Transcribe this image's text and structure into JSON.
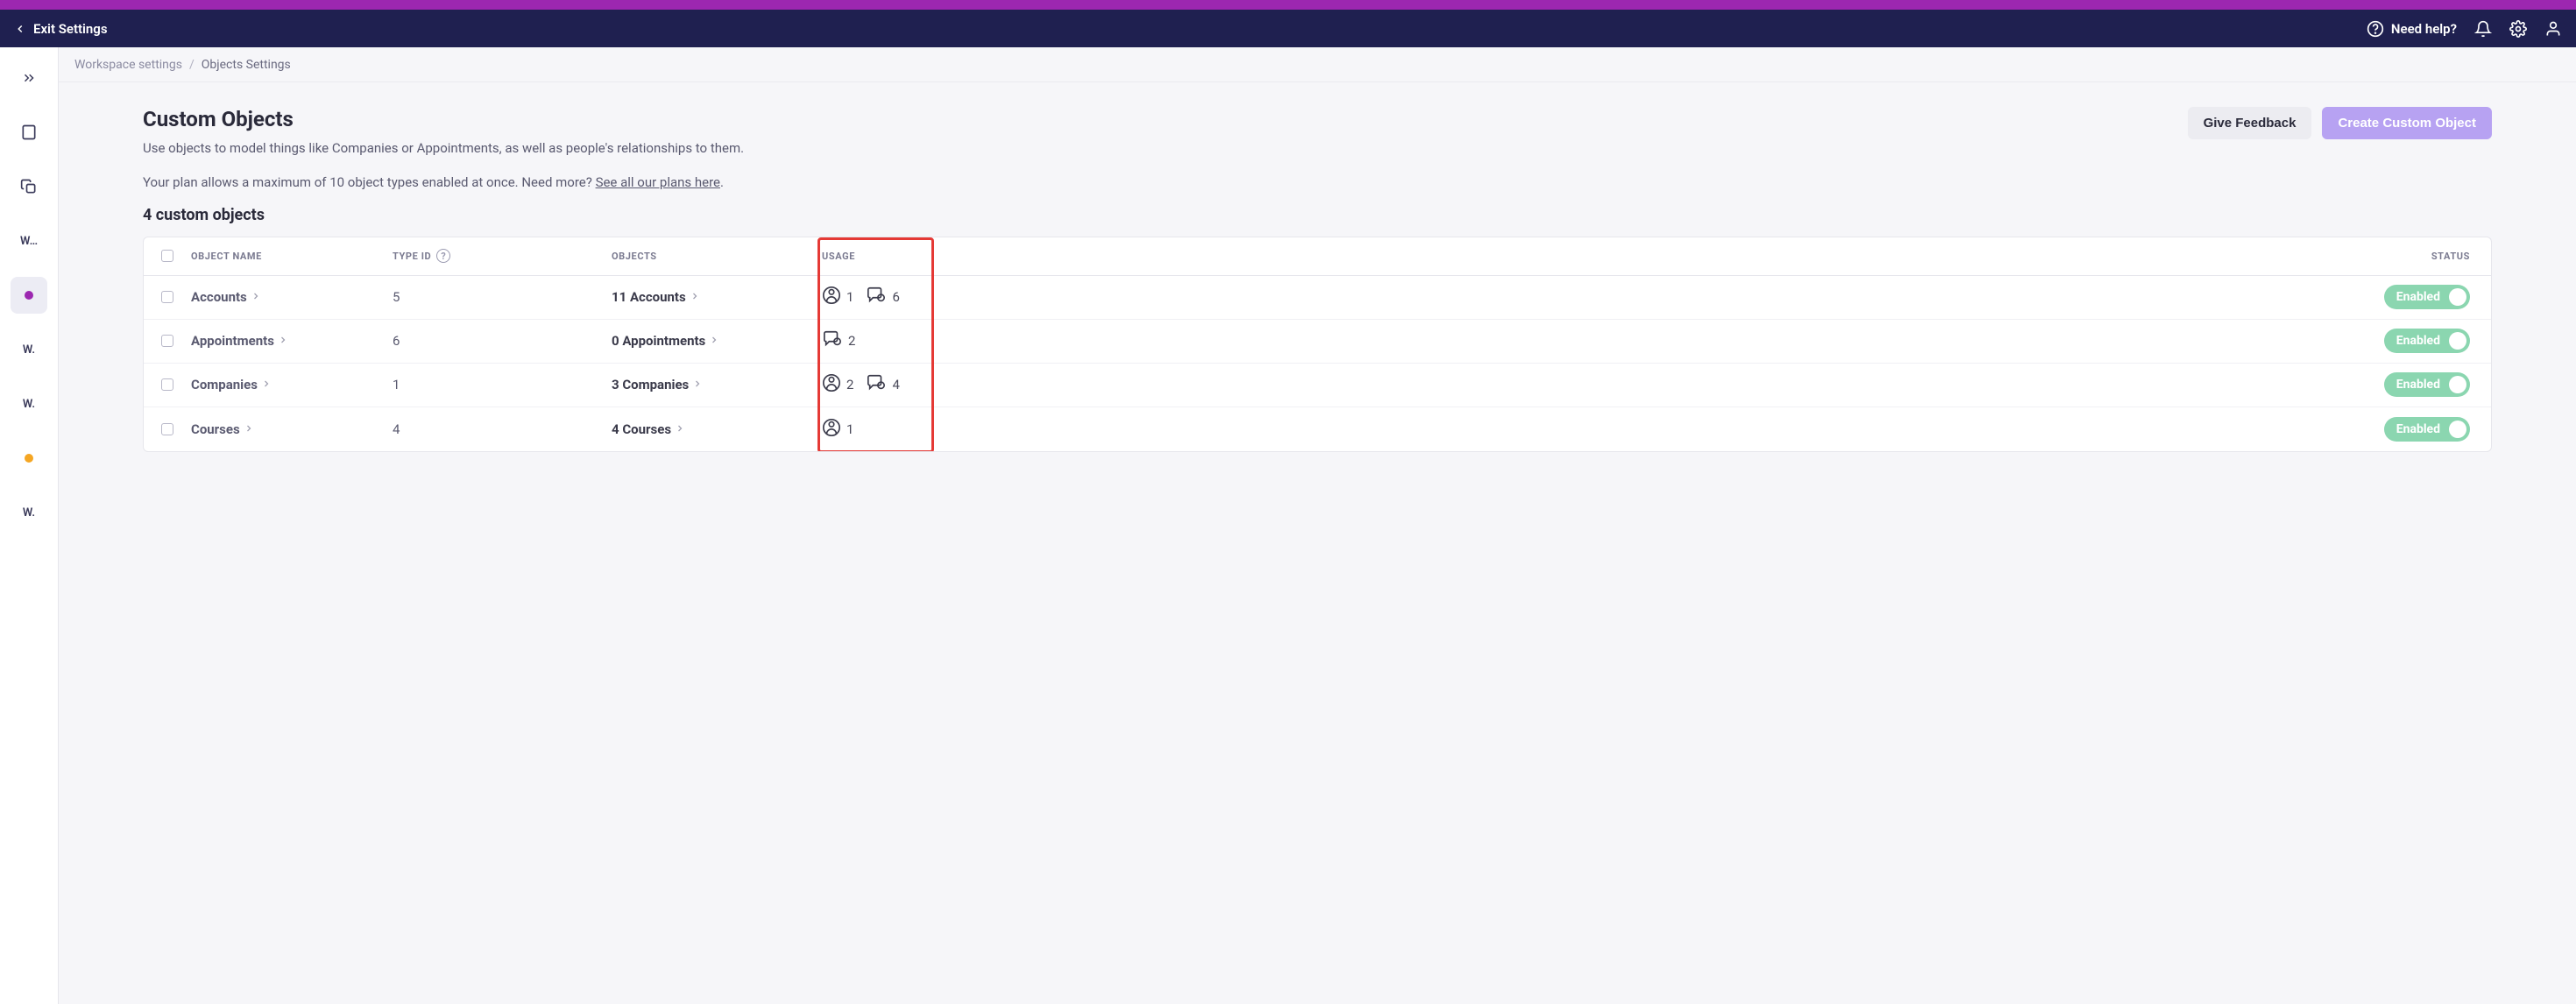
{
  "topbar": {
    "exit_label": "Exit Settings",
    "need_help": "Need help?"
  },
  "rail": {
    "items": [
      {
        "type": "expand"
      },
      {
        "type": "building"
      },
      {
        "type": "copy"
      },
      {
        "type": "text",
        "label": "W…"
      },
      {
        "type": "dot",
        "color": "#9c27b0",
        "active": true
      },
      {
        "type": "text",
        "label": "W."
      },
      {
        "type": "text",
        "label": "W."
      },
      {
        "type": "dot",
        "color": "#f5a623"
      },
      {
        "type": "text",
        "label": "W."
      }
    ]
  },
  "breadcrumb": {
    "root": "Workspace settings",
    "current": "Objects Settings"
  },
  "header": {
    "title": "Custom Objects",
    "description": "Use objects to model things like Companies or Appointments, as well as people's relationships to them.",
    "plan_note_prefix": "Your plan allows a maximum of 10 object types enabled at once. Need more? ",
    "plan_link": "See all our plans here",
    "plan_note_suffix": ".",
    "count_heading": "4 custom objects",
    "feedback_button": "Give Feedback",
    "create_button": "Create Custom Object"
  },
  "table": {
    "columns": {
      "name": "OBJECT NAME",
      "type_id": "TYPE ID",
      "objects": "OBJECTS",
      "usage": "USAGE",
      "status": "STATUS"
    },
    "rows": [
      {
        "name": "Accounts",
        "type_id": "5",
        "objects": "11 Accounts",
        "usage_people": "1",
        "usage_msgs": "6",
        "status": "Enabled"
      },
      {
        "name": "Appointments",
        "type_id": "6",
        "objects": "0 Appointments",
        "usage_people": null,
        "usage_msgs": "2",
        "status": "Enabled"
      },
      {
        "name": "Companies",
        "type_id": "1",
        "objects": "3 Companies",
        "usage_people": "2",
        "usage_msgs": "4",
        "status": "Enabled"
      },
      {
        "name": "Courses",
        "type_id": "4",
        "objects": "4 Courses",
        "usage_people": "1",
        "usage_msgs": null,
        "status": "Enabled"
      }
    ]
  }
}
